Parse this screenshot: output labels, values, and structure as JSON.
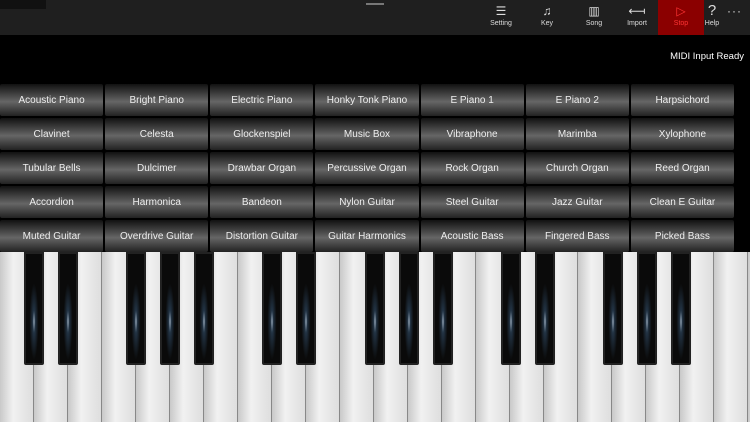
{
  "toolbar": {
    "items": [
      {
        "label": "Setting",
        "icon": "list-icon"
      },
      {
        "label": "Key",
        "icon": "music-note-icon"
      },
      {
        "label": "Song",
        "icon": "library-icon"
      },
      {
        "label": "Import",
        "icon": "arrow-left-icon"
      },
      {
        "label": "Stop",
        "icon": "play-outline-icon",
        "active": true
      },
      {
        "label": "Help",
        "icon": "question-icon"
      }
    ],
    "more": "···"
  },
  "status": "MIDI Input Ready",
  "instruments": [
    "Acoustic Piano",
    "Bright Piano",
    "Electric Piano",
    "Honky Tonk Piano",
    "E Piano 1",
    "E Piano 2",
    "Harpsichord",
    "Clavinet",
    "Celesta",
    "Glockenspiel",
    "Music Box",
    "Vibraphone",
    "Marimba",
    "Xylophone",
    "Tubular Bells",
    "Dulcimer",
    "Drawbar Organ",
    "Percussive Organ",
    "Rock Organ",
    "Church Organ",
    "Reed Organ",
    "Accordion",
    "Harmonica",
    "Bandeon",
    "Nylon Guitar",
    "Steel Guitar",
    "Jazz Guitar",
    "Clean E Guitar",
    "Muted Guitar",
    "Overdrive Guitar",
    "Distortion Guitar",
    "Guitar Harmonics",
    "Acoustic Bass",
    "Fingered Bass",
    "Picked Bass"
  ],
  "colors": {
    "stop_bg": "#8b0000",
    "stop_fg": "#ff3333"
  }
}
